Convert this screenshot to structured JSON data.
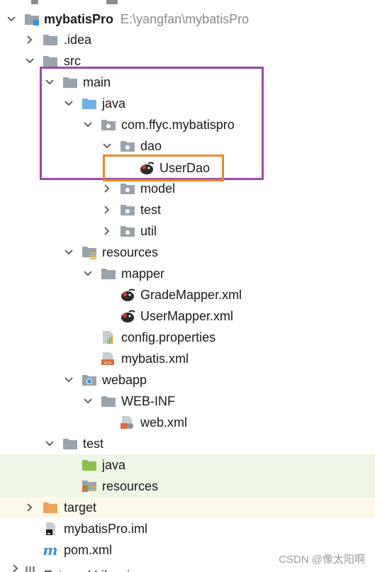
{
  "colors": {
    "folder_gray": "#9aa3ab",
    "folder_blue": "#6db1e6",
    "folder_green": "#8bc34a",
    "folder_orange": "#f0a15a",
    "highlight_purple": "#9b4aa8",
    "highlight_orange": "#f08a24",
    "row_green": "#eef6e6",
    "row_yellow": "#fcf9ea"
  },
  "tree": {
    "root": {
      "name": "mybatisPro",
      "path": "E:\\yangfan\\mybatisPro",
      "icon": "module-folder-icon"
    },
    "nodes": [
      {
        "label": "idea",
        "display": ".idea",
        "icon": "folder-icon"
      },
      {
        "label": "src",
        "display": "src",
        "icon": "folder-icon"
      },
      {
        "label": "main",
        "display": "main",
        "icon": "folder-icon"
      },
      {
        "label": "java",
        "display": "java",
        "icon": "source-folder-icon"
      },
      {
        "label": "package",
        "display": "com.ffyc.mybatispro",
        "icon": "package-icon"
      },
      {
        "label": "dao",
        "display": "dao",
        "icon": "package-icon"
      },
      {
        "label": "userdao",
        "display": "UserDao",
        "icon": "mybatis-bird-icon"
      },
      {
        "label": "model",
        "display": "model",
        "icon": "package-icon"
      },
      {
        "label": "test-pkg",
        "display": "test",
        "icon": "package-icon"
      },
      {
        "label": "util",
        "display": "util",
        "icon": "package-icon"
      },
      {
        "label": "resources",
        "display": "resources",
        "icon": "resources-folder-icon"
      },
      {
        "label": "mapper",
        "display": "mapper",
        "icon": "folder-icon"
      },
      {
        "label": "grademapper",
        "display": "GradeMapper.xml",
        "icon": "mybatis-bird-icon"
      },
      {
        "label": "usermapper",
        "display": "UserMapper.xml",
        "icon": "mybatis-bird-icon"
      },
      {
        "label": "config",
        "display": "config.properties",
        "icon": "properties-file-icon"
      },
      {
        "label": "mybatisxml",
        "display": "mybatis.xml",
        "icon": "xml-file-icon"
      },
      {
        "label": "webapp",
        "display": "webapp",
        "icon": "web-folder-icon"
      },
      {
        "label": "webinf",
        "display": "WEB-INF",
        "icon": "folder-icon"
      },
      {
        "label": "webxml",
        "display": "web.xml",
        "icon": "web-xml-icon"
      },
      {
        "label": "test",
        "display": "test",
        "icon": "folder-icon"
      },
      {
        "label": "testjava",
        "display": "java",
        "icon": "test-source-folder-icon"
      },
      {
        "label": "testresources",
        "display": "resources",
        "icon": "test-resources-folder-icon"
      },
      {
        "label": "target",
        "display": "target",
        "icon": "excluded-folder-icon"
      },
      {
        "label": "iml",
        "display": "mybatisPro.iml",
        "icon": "iml-file-icon"
      },
      {
        "label": "pom",
        "display": "pom.xml",
        "icon": "maven-icon"
      },
      {
        "label": "ext",
        "display": "External Libraries",
        "icon": "libraries-icon"
      }
    ]
  },
  "watermark": "CSDN @像太阳啊"
}
